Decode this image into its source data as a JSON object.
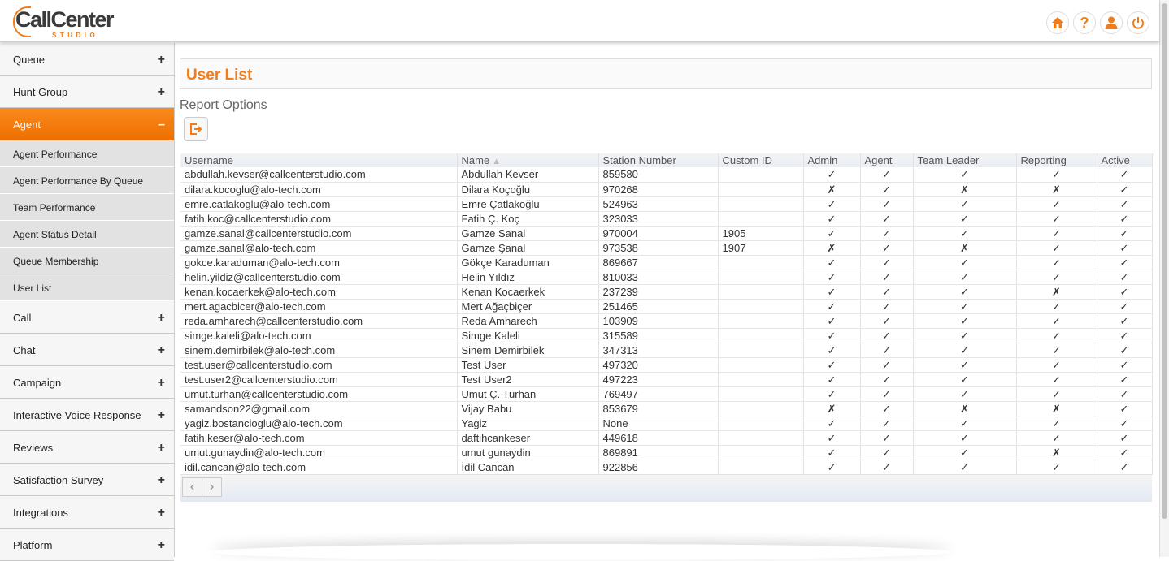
{
  "header": {
    "logo_text": "CallCenter",
    "logo_sub": "STUDIO",
    "icons": [
      "home-icon",
      "help-icon",
      "user-icon",
      "power-icon"
    ],
    "help_glyph": "?"
  },
  "colors": {
    "accent": "#f07d1a",
    "sidebar_bg": "#f1f1f1",
    "active_menu": "#f57f10"
  },
  "sidebar": {
    "queue": {
      "label": "Queue",
      "toggle": "+"
    },
    "hunt_group": {
      "label": "Hunt Group",
      "toggle": "+"
    },
    "agent": {
      "label": "Agent",
      "toggle": "–"
    },
    "agent_sub": [
      {
        "label": "Agent Performance"
      },
      {
        "label": "Agent Performance By Queue"
      },
      {
        "label": "Team Performance"
      },
      {
        "label": "Agent Status Detail"
      },
      {
        "label": "Queue Membership"
      },
      {
        "label": "User List"
      }
    ],
    "call": {
      "label": "Call",
      "toggle": "+"
    },
    "chat": {
      "label": "Chat",
      "toggle": "+"
    },
    "campaign": {
      "label": "Campaign",
      "toggle": "+"
    },
    "ivr": {
      "label": "Interactive Voice Response",
      "toggle": "+"
    },
    "reviews": {
      "label": "Reviews",
      "toggle": "+"
    },
    "satisfaction": {
      "label": "Satisfaction Survey",
      "toggle": "+"
    },
    "integrations": {
      "label": "Integrations",
      "toggle": "+"
    },
    "platform": {
      "label": "Platform",
      "toggle": "+"
    }
  },
  "main": {
    "title": "User List",
    "report_options": "Report Options"
  },
  "table": {
    "columns": [
      "Username",
      "Name",
      "Station Number",
      "Custom ID",
      "Admin",
      "Agent",
      "Team Leader",
      "Reporting",
      "Active"
    ],
    "sort_arrow": "▲",
    "rows": [
      [
        "abdullah.kevser@callcenterstudio.com",
        "Abdullah Kevser",
        "859580",
        "",
        "✓",
        "✓",
        "✓",
        "✓",
        "✓"
      ],
      [
        "dilara.kocoglu@alo-tech.com",
        "Dilara Koçoğlu",
        "970268",
        "",
        "✗",
        "✓",
        "✗",
        "✗",
        "✓"
      ],
      [
        "emre.catlakoglu@alo-tech.com",
        "Emre Çatlakoğlu",
        "524963",
        "",
        "✓",
        "✓",
        "✓",
        "✓",
        "✓"
      ],
      [
        "fatih.koc@callcenterstudio.com",
        "Fatih Ç. Koç",
        "323033",
        "",
        "✓",
        "✓",
        "✓",
        "✓",
        "✓"
      ],
      [
        "gamze.sanal@callcenterstudio.com",
        "Gamze Sanal",
        "970004",
        "1905",
        "✓",
        "✓",
        "✓",
        "✓",
        "✓"
      ],
      [
        "gamze.sanal@alo-tech.com",
        "Gamze Şanal",
        "973538",
        "1907",
        "✗",
        "✓",
        "✗",
        "✓",
        "✓"
      ],
      [
        "gokce.karaduman@alo-tech.com",
        "Gökçe Karaduman",
        "869667",
        "",
        "✓",
        "✓",
        "✓",
        "✓",
        "✓"
      ],
      [
        "helin.yildiz@callcenterstudio.com",
        "Helin Yıldız",
        "810033",
        "",
        "✓",
        "✓",
        "✓",
        "✓",
        "✓"
      ],
      [
        "kenan.kocaerkek@alo-tech.com",
        "Kenan Kocaerkek",
        "237239",
        "",
        "✓",
        "✓",
        "✓",
        "✗",
        "✓"
      ],
      [
        "mert.agacbicer@alo-tech.com",
        "Mert Ağaçbiçer",
        "251465",
        "",
        "✓",
        "✓",
        "✓",
        "✓",
        "✓"
      ],
      [
        "reda.amharech@callcenterstudio.com",
        "Reda Amharech",
        "103909",
        "",
        "✓",
        "✓",
        "✓",
        "✓",
        "✓"
      ],
      [
        "simge.kaleli@alo-tech.com",
        "Simge Kaleli",
        "315589",
        "",
        "✓",
        "✓",
        "✓",
        "✓",
        "✓"
      ],
      [
        "sinem.demirbilek@alo-tech.com",
        "Sinem Demirbilek",
        "347313",
        "",
        "✓",
        "✓",
        "✓",
        "✓",
        "✓"
      ],
      [
        "test.user@callcenterstudio.com",
        "Test User",
        "497320",
        "",
        "✓",
        "✓",
        "✓",
        "✓",
        "✓"
      ],
      [
        "test.user2@callcenterstudio.com",
        "Test User2",
        "497223",
        "",
        "✓",
        "✓",
        "✓",
        "✓",
        "✓"
      ],
      [
        "umut.turhan@callcenterstudio.com",
        "Umut Ç. Turhan",
        "769497",
        "",
        "✓",
        "✓",
        "✓",
        "✓",
        "✓"
      ],
      [
        "samandson22@gmail.com",
        "Vijay Babu",
        "853679",
        "",
        "✗",
        "✓",
        "✗",
        "✗",
        "✓"
      ],
      [
        "yagiz.bostancioglu@alo-tech.com",
        "Yagiz",
        "None",
        "",
        "✓",
        "✓",
        "✓",
        "✓",
        "✓"
      ],
      [
        "fatih.keser@alo-tech.com",
        "daftihcankeser",
        "449618",
        "",
        "✓",
        "✓",
        "✓",
        "✓",
        "✓"
      ],
      [
        "umut.gunaydin@alo-tech.com",
        "umut gunaydin",
        "869891",
        "",
        "✓",
        "✓",
        "✓",
        "✗",
        "✓"
      ],
      [
        "idil.cancan@alo-tech.com",
        "İdil Cancan",
        "922856",
        "",
        "✓",
        "✓",
        "✓",
        "✓",
        "✓"
      ]
    ]
  },
  "pager": {
    "prev": "‹",
    "next": "›"
  }
}
